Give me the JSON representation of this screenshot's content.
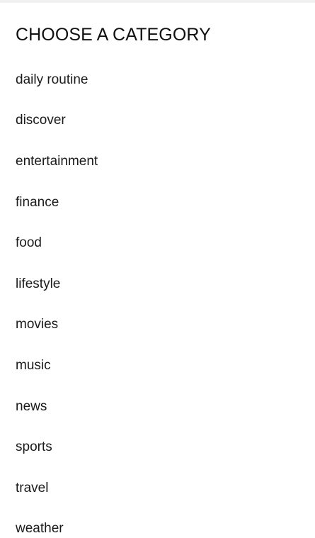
{
  "header": {
    "title": "CHOOSE A CATEGORY"
  },
  "categories": [
    {
      "label": "daily routine"
    },
    {
      "label": "discover"
    },
    {
      "label": "entertainment"
    },
    {
      "label": "finance"
    },
    {
      "label": "food"
    },
    {
      "label": "lifestyle"
    },
    {
      "label": "movies"
    },
    {
      "label": "music"
    },
    {
      "label": "news"
    },
    {
      "label": "sports"
    },
    {
      "label": "travel"
    },
    {
      "label": "weather"
    }
  ]
}
